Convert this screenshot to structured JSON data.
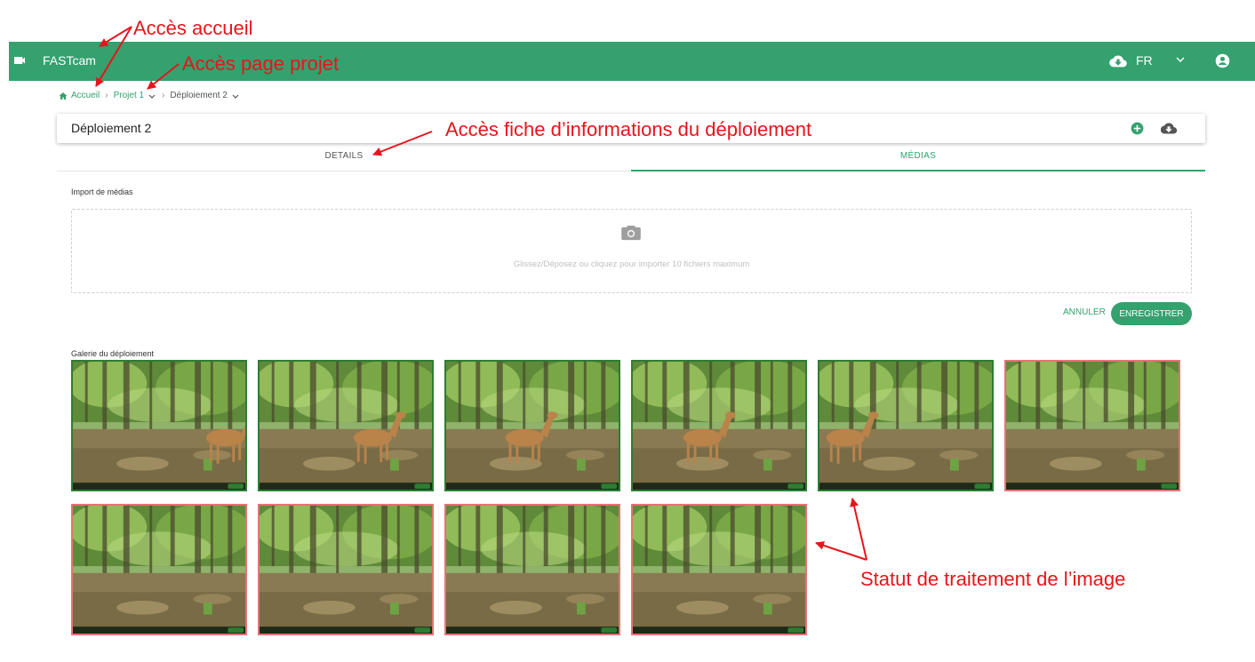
{
  "annotations": {
    "home_access": "Accès accueil",
    "project_access": "Accès page projet",
    "deployment_info_access": "Accès fiche d’informations du déploiement",
    "image_status": "Statut de traitement de l’image"
  },
  "appbar": {
    "brand": "FASTcam",
    "language": "FR",
    "color": "#34a16f",
    "icons": [
      "videocam-icon",
      "cloud-download-icon",
      "chevron-down-icon",
      "account-icon"
    ]
  },
  "breadcrumb": {
    "home": "Accueil",
    "project": "Projet 1",
    "deployment": "Déploiement 2",
    "separator": "›"
  },
  "header": {
    "title": "Déploiement 2",
    "icons": [
      "add-circle-icon",
      "cloud-download-icon"
    ]
  },
  "tabs": [
    {
      "label": "DETAILS",
      "active": false
    },
    {
      "label": "MÉDIAS",
      "active": true
    }
  ],
  "import": {
    "label": "Import de médias",
    "dropzone_text": "Glissez/Déposez ou cliquez pour importer 10 fichiers maximum",
    "icon": "camera-icon"
  },
  "actions": {
    "cancel": "ANNULER",
    "save": "ENREGISTRER"
  },
  "gallery": {
    "label": "Galerie du déploiement",
    "status_colors": {
      "processed": "#2e7d32",
      "pending": "#e57373"
    },
    "items": [
      {
        "status": "processed",
        "animal": true
      },
      {
        "status": "processed",
        "animal": true
      },
      {
        "status": "processed",
        "animal": true
      },
      {
        "status": "processed",
        "animal": true
      },
      {
        "status": "processed",
        "animal": true
      },
      {
        "status": "pending",
        "animal": false
      },
      {
        "status": "pending",
        "animal": false
      },
      {
        "status": "pending",
        "animal": false
      },
      {
        "status": "pending",
        "animal": false
      },
      {
        "status": "pending",
        "animal": false
      }
    ]
  }
}
